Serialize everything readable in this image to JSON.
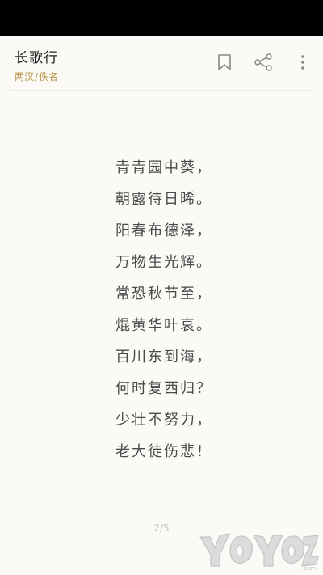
{
  "header": {
    "title": "长歌行",
    "dynasty": "两汉",
    "separator": "/",
    "author": "佚名",
    "actions": [
      {
        "name": "bookmark",
        "icon": "bookmark-icon"
      },
      {
        "name": "share",
        "icon": "share-icon"
      },
      {
        "name": "more",
        "icon": "more-vertical-icon"
      }
    ]
  },
  "poem": {
    "lines": [
      "青青园中葵，",
      "朝露待日晞。",
      "阳春布德泽，",
      "万物生光辉。",
      "常恐秋节至，",
      "焜黄华叶衰。",
      "百川东到海，",
      "何时复西归？",
      "少壮不努力，",
      "老大徒伤悲！"
    ]
  },
  "pagination": {
    "current": 2,
    "total": 5,
    "label": "2/5"
  },
  "watermark": {
    "text": "YOYOZ.com",
    "icon": "yoyoz-logo"
  },
  "colors": {
    "background": "#fbfaf6",
    "status_bar": "#000000",
    "accent": "#b8944a",
    "icon": "#888888",
    "poem_text": "#4a4a4a"
  }
}
